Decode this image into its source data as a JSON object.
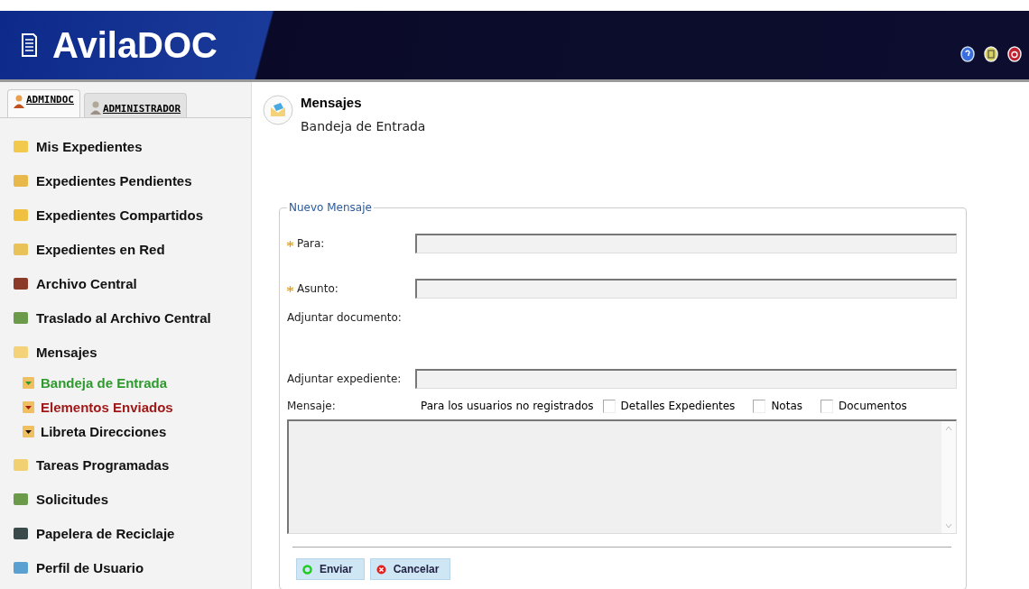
{
  "header": {
    "logo": "AvilaDOC"
  },
  "user_tabs": [
    {
      "label": "ADMINDOC",
      "selected": true
    },
    {
      "label": "ADMINISTRADOR",
      "selected": false
    }
  ],
  "sidebar": {
    "items": [
      {
        "label": "Mis Expedientes"
      },
      {
        "label": "Expedientes Pendientes"
      },
      {
        "label": "Expedientes Compartidos"
      },
      {
        "label": "Expedientes en Red"
      },
      {
        "label": "Archivo Central"
      },
      {
        "label": "Traslado al Archivo Central"
      },
      {
        "label": "Mensajes",
        "children": [
          {
            "label": "Bandeja de Entrada",
            "color": "#2e9a2e"
          },
          {
            "label": "Elementos Enviados",
            "color": "#a01818"
          },
          {
            "label": "Libreta Direcciones",
            "color": "#111111"
          }
        ]
      },
      {
        "label": "Tareas Programadas"
      },
      {
        "label": "Solicitudes"
      },
      {
        "label": "Papelera de Reciclaje"
      },
      {
        "label": "Perfil de Usuario"
      }
    ]
  },
  "page": {
    "title": "Mensajes",
    "subtitle": "Bandeja de Entrada"
  },
  "form": {
    "legend": "Nuevo Mensaje",
    "fields": [
      {
        "label": "Para:",
        "required": true,
        "kind": "input"
      },
      {
        "label": "Asunto:",
        "required": true,
        "kind": "input"
      },
      {
        "label": "Adjuntar documento:",
        "required": false,
        "kind": "none"
      },
      {
        "label": "Adjuntar expediente:",
        "required": false,
        "kind": "input"
      }
    ],
    "message_label": "Mensaje:",
    "unregistered_label": "Para los usuarios no registrados",
    "options": [
      {
        "label": "Detalles Expedientes",
        "checked": false
      },
      {
        "label": "Notas",
        "checked": false
      },
      {
        "label": "Documentos",
        "checked": false
      }
    ],
    "buttons": [
      {
        "label": "Enviar",
        "kind": "send"
      },
      {
        "label": "Cancelar",
        "kind": "cancel"
      }
    ]
  }
}
